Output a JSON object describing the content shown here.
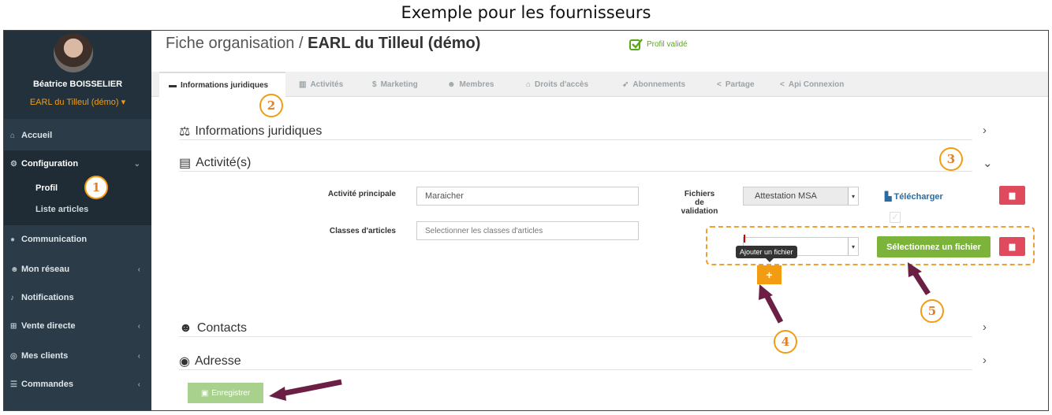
{
  "caption": "Exemple pour les fournisseurs",
  "sidebar": {
    "user_name": "Béatrice BOISSELIER",
    "org_name": "EARL du Tilleul (démo)",
    "items": [
      {
        "label": "Accueil",
        "icon": "home-icon"
      },
      {
        "label": "Configuration",
        "icon": "cogs-icon"
      },
      {
        "label": "Communication",
        "icon": "comments-icon"
      },
      {
        "label": "Mon réseau",
        "icon": "users-icon"
      },
      {
        "label": "Notifications",
        "icon": "bell-icon"
      },
      {
        "label": "Vente directe",
        "icon": "cart-icon"
      },
      {
        "label": "Mes clients",
        "icon": "handshake-icon"
      },
      {
        "label": "Commandes",
        "icon": "list-icon"
      }
    ],
    "sub_items": [
      "Profil",
      "Liste articles"
    ]
  },
  "header": {
    "title_prefix": "Fiche organisation / ",
    "title_org": "EARL du Tilleul (démo)",
    "status": "Profil validé"
  },
  "tabs": [
    {
      "label": "Informations juridiques",
      "active": true
    },
    {
      "label": "Activités"
    },
    {
      "label": "Marketing"
    },
    {
      "label": "Membres"
    },
    {
      "label": "Droits d'accès"
    },
    {
      "label": "Abonnements"
    },
    {
      "label": "Partage"
    },
    {
      "label": "Api Connexion"
    }
  ],
  "sections": {
    "legal": "Informations juridiques",
    "activity": "Activité(s)",
    "contacts": "Contacts",
    "address": "Adresse"
  },
  "form": {
    "main_activity_label": "Activité principale",
    "main_activity_value": "Maraicher",
    "classes_label": "Classes d'articles",
    "classes_placeholder": "Selectionner les classes d'articles",
    "files_label": "Fichiers de validation",
    "file_type_value": "Attestation MSA",
    "download_label": "Télécharger",
    "add_file_tooltip": "Ajouter un fichier",
    "add_button": "+",
    "select_file_button": "Sélectionnez un fichier",
    "save_button": "Enregistrer"
  },
  "callouts": [
    "1",
    "2",
    "3",
    "4",
    "5"
  ],
  "colors": {
    "sidebar_bg": "#2b3b47",
    "accent_orange": "#f39c12",
    "green": "#7bb33b",
    "danger": "#e04a5f",
    "arrow": "#6b1f45"
  }
}
